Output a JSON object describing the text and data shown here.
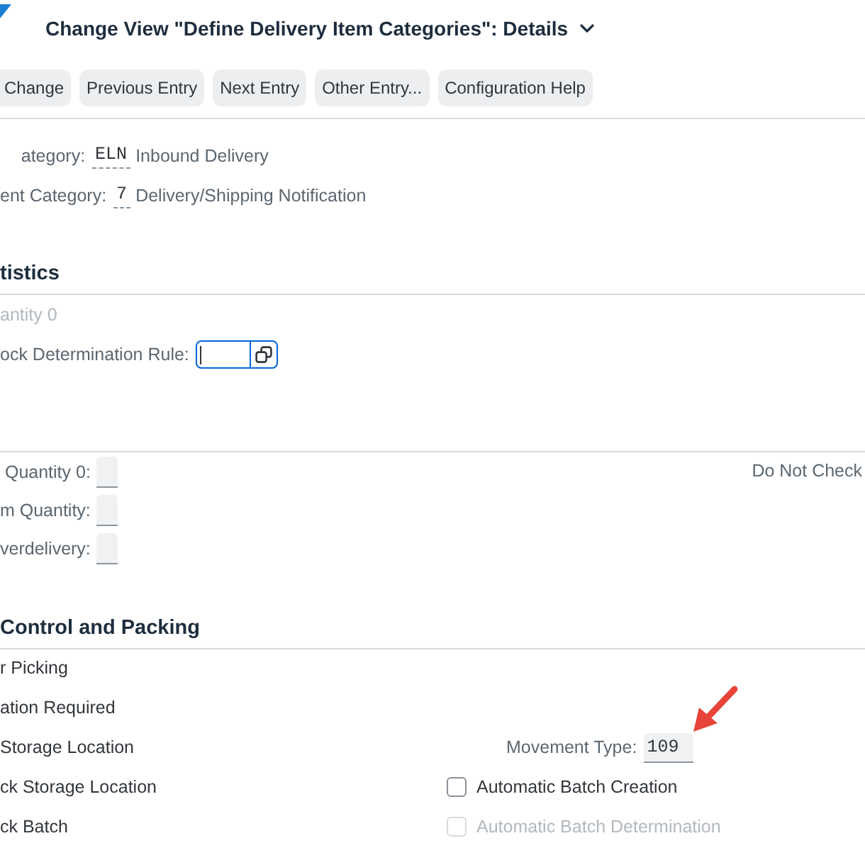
{
  "header": {
    "title": "Change View \"Define Delivery Item Categories\": Details"
  },
  "toolbar": {
    "buttons": [
      "Change",
      "Previous Entry",
      "Next Entry",
      "Other Entry...",
      "Configuration Help"
    ]
  },
  "header_fields": [
    {
      "label": "ategory:",
      "value": "ELN",
      "description": "Inbound Delivery"
    },
    {
      "label": "ent Category:",
      "value": "7",
      "description": "Delivery/Shipping Notification"
    }
  ],
  "statistics": {
    "title": "tistics",
    "rows": [
      {
        "kind": "text",
        "label": "antity 0",
        "disabled": true
      },
      {
        "kind": "input",
        "label": "ock Determination Rule:",
        "focused": true
      }
    ]
  },
  "quantities": {
    "rows": [
      "Quantity 0:",
      "m Quantity:",
      "verdelivery:"
    ],
    "right_label": "Do Not Check"
  },
  "control_packing": {
    "title": "Control and Packing",
    "items": [
      "r Picking",
      "ation Required",
      "Storage Location",
      "ck Storage Location",
      "ck Batch"
    ],
    "movement_type": {
      "label": "Movement Type:",
      "value": "109"
    },
    "checkboxes": [
      {
        "label": "Automatic Batch Creation",
        "checked": false,
        "disabled": false
      },
      {
        "label": "Automatic Batch Determination",
        "checked": false,
        "disabled": true
      }
    ]
  }
}
